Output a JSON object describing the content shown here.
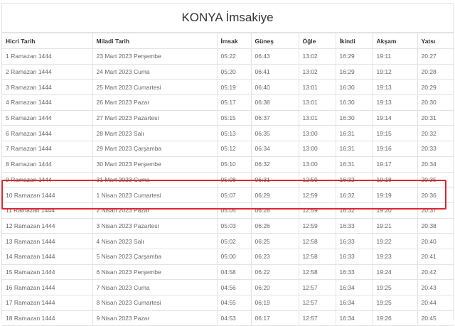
{
  "title": "KONYA İmsakiye",
  "columns": [
    "Hicri Tarih",
    "Miladi Tarih",
    "İmsak",
    "Güneş",
    "Öğle",
    "İkindi",
    "Akşam",
    "Yatsı"
  ],
  "rows": [
    [
      "1 Ramazan 1444",
      "23 Mart 2023 Perşembe",
      "05:22",
      "06:43",
      "13:02",
      "16:29",
      "19:11",
      "20:27"
    ],
    [
      "2 Ramazan 1444",
      "24 Mart 2023 Cuma",
      "05:20",
      "06:41",
      "13:02",
      "16:29",
      "19:12",
      "20:28"
    ],
    [
      "3 Ramazan 1444",
      "25 Mart 2023 Cumartesi",
      "05:19",
      "06:40",
      "13:01",
      "16:30",
      "19:13",
      "20:29"
    ],
    [
      "4 Ramazan 1444",
      "26 Mart 2023 Pazar",
      "05:17",
      "06:38",
      "13:01",
      "16:30",
      "19:13",
      "20:30"
    ],
    [
      "5 Ramazan 1444",
      "27 Mart 2023 Pazartesi",
      "05:15",
      "06:37",
      "13:01",
      "16:30",
      "19:14",
      "20:31"
    ],
    [
      "6 Ramazan 1444",
      "28 Mart 2023 Salı",
      "05:13",
      "06:35",
      "13:00",
      "16:31",
      "19:15",
      "20:32"
    ],
    [
      "7 Ramazan 1444",
      "29 Mart 2023 Çarşamba",
      "05:12",
      "06:34",
      "13:00",
      "16:31",
      "19:16",
      "20:33"
    ],
    [
      "8 Ramazan 1444",
      "30 Mart 2023 Perşembe",
      "05:10",
      "06:32",
      "13:00",
      "16:31",
      "19:17",
      "20:34"
    ],
    [
      "9 Ramazan 1444",
      "31 Mart 2023 Cuma",
      "05:08",
      "06:31",
      "12:59",
      "16:32",
      "19:18",
      "20:35"
    ],
    [
      "10 Ramazan 1444",
      "1 Nisan 2023 Cumartesi",
      "05:07",
      "06:29",
      "12:59",
      "16:32",
      "19:19",
      "20:36"
    ],
    [
      "11 Ramazan 1444",
      "2 Nisan 2023 Pazar",
      "05:05",
      "06:28",
      "12:59",
      "16:32",
      "19:20",
      "20:37"
    ],
    [
      "12 Ramazan 1444",
      "3 Nisan 2023 Pazartesi",
      "05:03",
      "06:26",
      "12:59",
      "16:33",
      "19:21",
      "20:38"
    ],
    [
      "13 Ramazan 1444",
      "4 Nisan 2023 Salı",
      "05:02",
      "06:25",
      "12:58",
      "16:33",
      "19:22",
      "20:40"
    ],
    [
      "14 Ramazan 1444",
      "5 Nisan 2023 Çarşamba",
      "05:00",
      "06:23",
      "12:58",
      "16:33",
      "19:23",
      "20:41"
    ],
    [
      "15 Ramazan 1444",
      "6 Nisan 2023 Perşembe",
      "04:58",
      "06:22",
      "12:58",
      "16:33",
      "19:24",
      "20:42"
    ],
    [
      "16 Ramazan 1444",
      "7 Nisan 2023 Cuma",
      "04:56",
      "06:20",
      "12:57",
      "16:34",
      "19:25",
      "20:43"
    ],
    [
      "17 Ramazan 1444",
      "8 Nisan 2023 Cumartesi",
      "04:55",
      "06:19",
      "12:57",
      "16:34",
      "19:25",
      "20:44"
    ],
    [
      "18 Ramazan 1444",
      "9 Nisan 2023 Pazar",
      "04:53",
      "06:17",
      "12:57",
      "16:34",
      "19:26",
      "20:45"
    ]
  ],
  "highlight_color": "#e2242b"
}
